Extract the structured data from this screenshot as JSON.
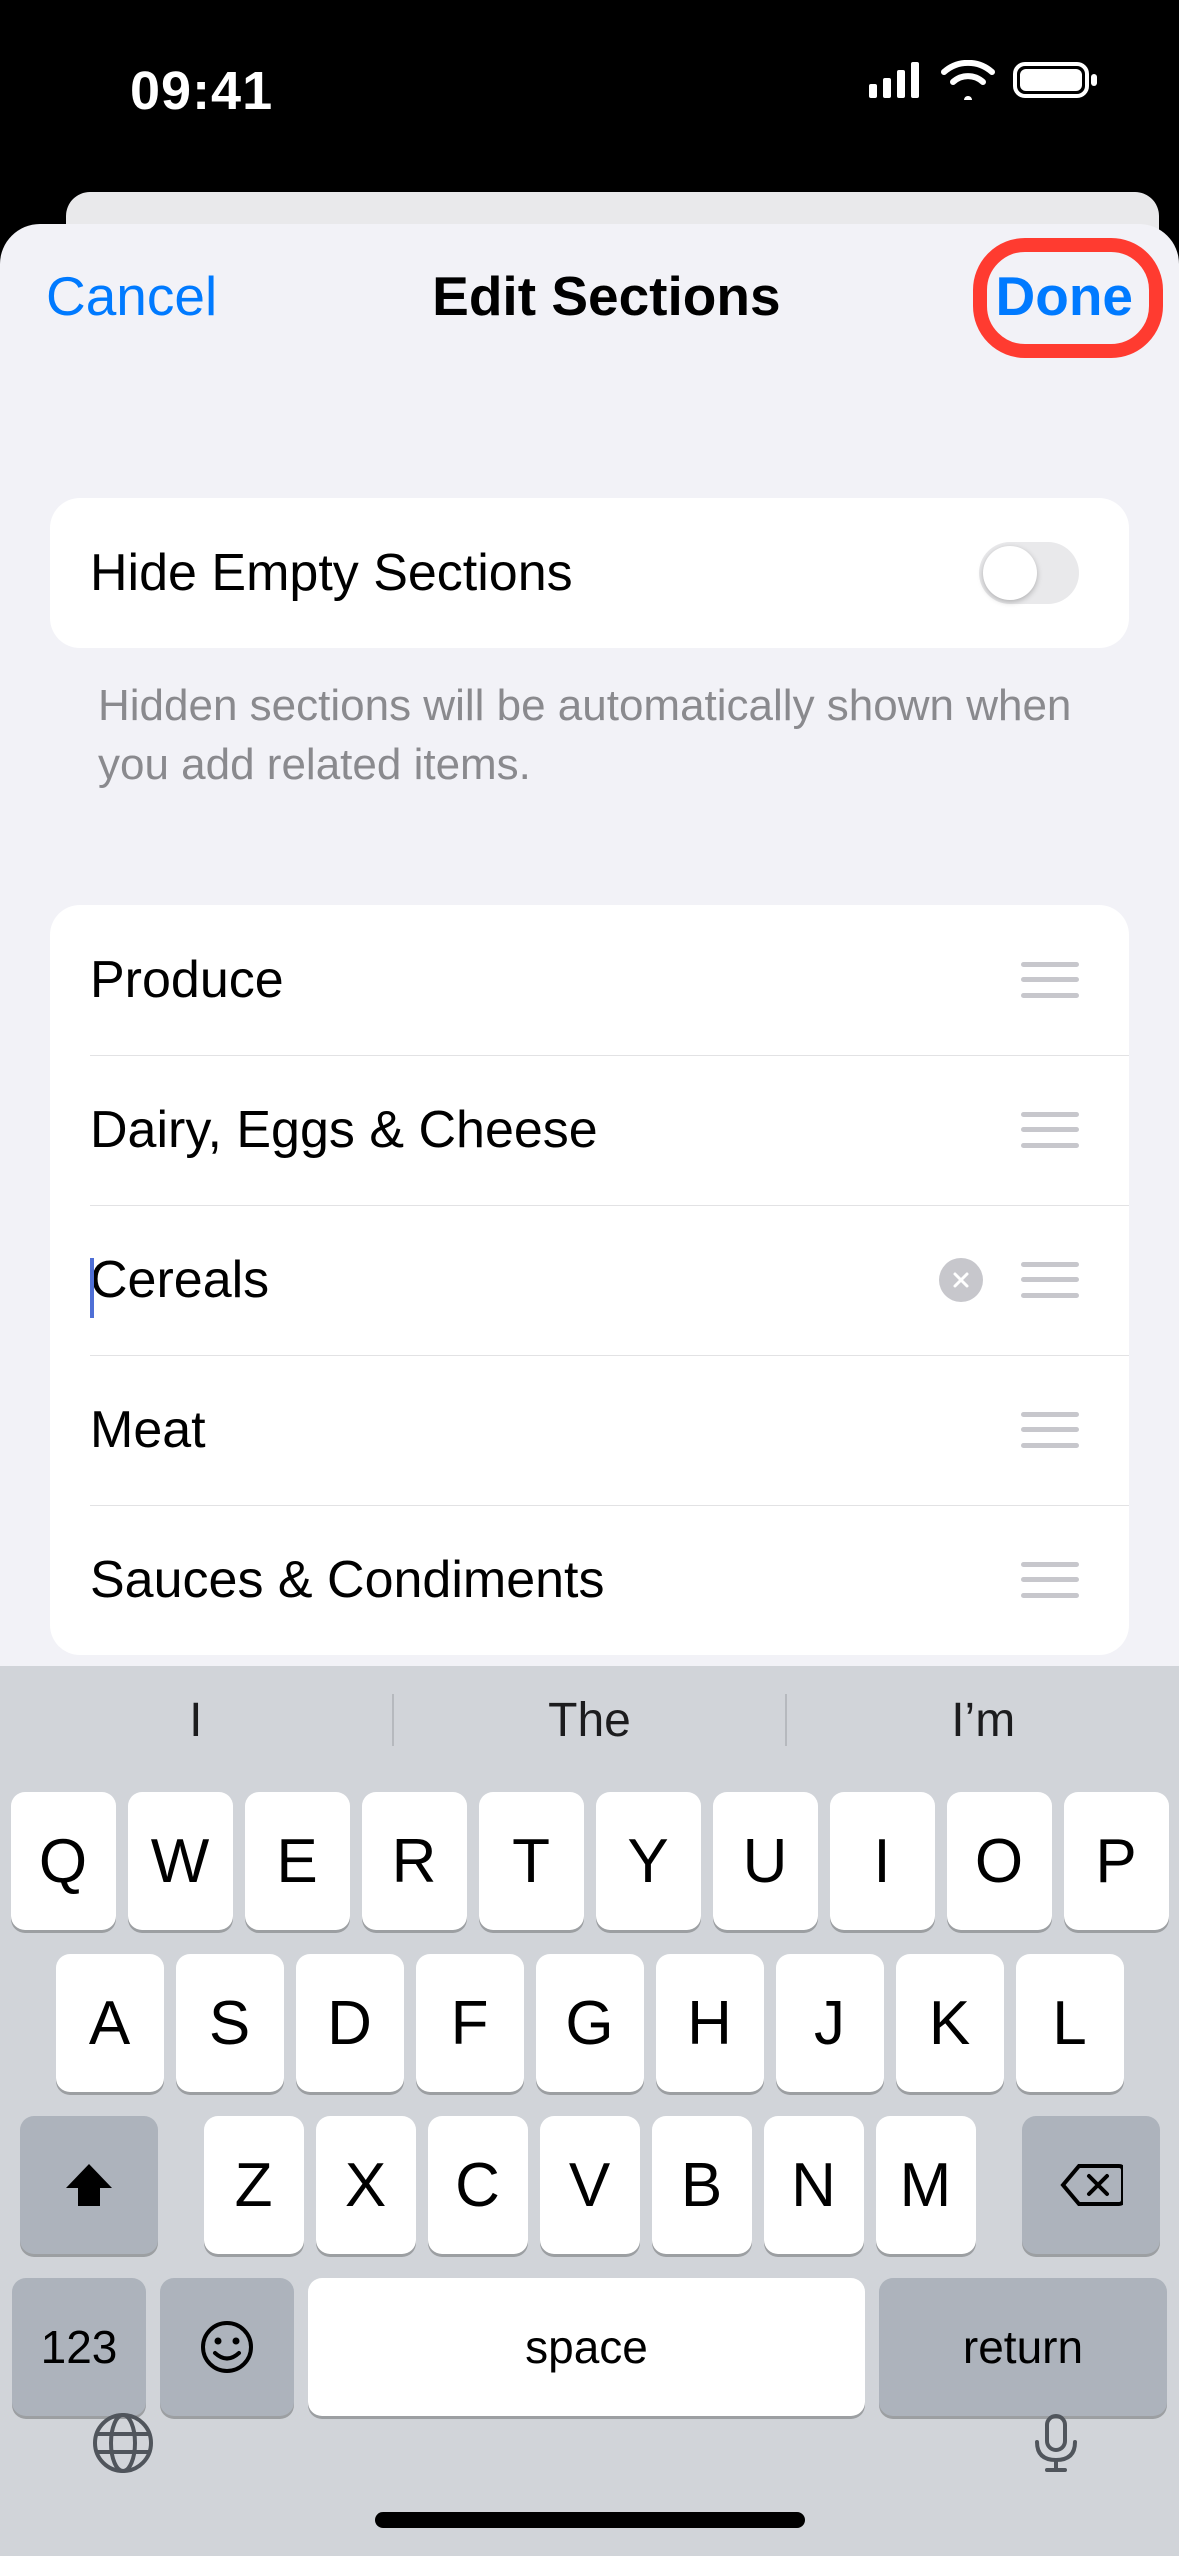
{
  "status": {
    "time": "09:41"
  },
  "nav": {
    "cancel": "Cancel",
    "title": "Edit Sections",
    "done": "Done"
  },
  "hideEmpty": {
    "label": "Hide Empty Sections",
    "hint": "Hidden sections will be automatically shown when you add related items.",
    "on": false
  },
  "sections": [
    {
      "name": "Produce",
      "editing": false
    },
    {
      "name": "Dairy, Eggs & Cheese",
      "editing": false
    },
    {
      "name": "Cereals",
      "editing": true
    },
    {
      "name": "Meat",
      "editing": false
    },
    {
      "name": "Sauces & Condiments",
      "editing": false
    }
  ],
  "keyboard": {
    "predictions": [
      "I",
      "The",
      "I’m"
    ],
    "rows": [
      [
        "Q",
        "W",
        "E",
        "R",
        "T",
        "Y",
        "U",
        "I",
        "O",
        "P"
      ],
      [
        "A",
        "S",
        "D",
        "F",
        "G",
        "H",
        "J",
        "K",
        "L"
      ],
      [
        "Z",
        "X",
        "C",
        "V",
        "B",
        "N",
        "M"
      ]
    ],
    "numKey": "123",
    "space": "space",
    "return": "return"
  }
}
